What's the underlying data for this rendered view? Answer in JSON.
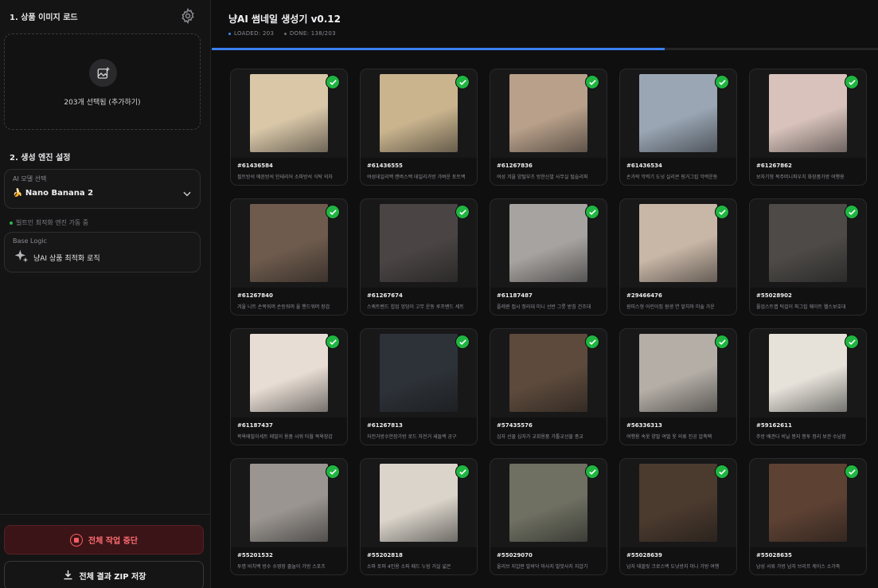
{
  "sidebar": {
    "section1_title": "1. 상품 이미지 로드",
    "upload_text": "203개 선택됨 (추가하기)",
    "section2_title": "2. 생성 엔진 설정",
    "model_label": "AI 모델 선택",
    "model_value": "🍌 Nano Banana 2",
    "engine_status": "빌트인 최적화 엔진 가동 중",
    "base_logic_label": "Base Logic",
    "base_logic_value": "냥AI 상품 최적화 로직",
    "stop_label": "전체 작업 중단",
    "zip_label": "전체 결과 ZIP 저장"
  },
  "header": {
    "title": "냥AI 썸네일 생성기 v0.12",
    "loaded": "LOADED: 203",
    "done": "DONE: 138/203",
    "progress": 0.68
  },
  "colors": {
    "accent": "#3b7ff0",
    "success": "#1fb541",
    "danger": "#ff5c63"
  },
  "products": [
    {
      "id": "#61436584",
      "name": "필트방석 에른방석 인테리어 소파방석 식탁 의자",
      "bg": "#d9c7a8"
    },
    {
      "id": "#61436555",
      "name": "여성데일리백 캔버스백 데일리가방 가벼운 토트백",
      "bg": "#c9b48e"
    },
    {
      "id": "#61267836",
      "name": "여성 겨울 양털부츠 방한신발 사무실 털슬리퍼",
      "bg": "#b8a08a"
    },
    {
      "id": "#61436534",
      "name": "손가락 악력기 도넛 실리콘 핑거그립 악력운동",
      "bg": "#9aa6b4"
    },
    {
      "id": "#61267862",
      "name": "보자기형 복주머니파우치 화장품가방 여행용",
      "bg": "#d8c2bb"
    },
    {
      "id": "#61267840",
      "name": "겨울 니트 손목워머 손등워머 울 핸드워머 장갑",
      "bg": "#6e5b4d"
    },
    {
      "id": "#61267674",
      "name": "스쿼트밴드 힙업 엉덩이 고무 운동 루프밴드 세트",
      "bg": "#4a4544"
    },
    {
      "id": "#61187487",
      "name": "플레퀸 접시 정리대 미니 선반 그릇 받침 건조대",
      "bg": "#a7a3a0"
    },
    {
      "id": "#29466476",
      "name": "원피스형 어린이집 원생 연 앞치마 미술 가운",
      "bg": "#c8b6a6"
    },
    {
      "id": "#55028902",
      "name": "풀업스트랩 턱걸이 파그립 웨이트 헬스보호대",
      "bg": "#4d4a47"
    },
    {
      "id": "#61187437",
      "name": "목욕때밀이세트 때밀이 용품 샤워 타월 목욕장갑",
      "bg": "#e8ddd4"
    },
    {
      "id": "#61267813",
      "name": "자전거방수안장가방 로드 자전거 새들백 공구",
      "bg": "#2d3238"
    },
    {
      "id": "#57435576",
      "name": "십자 선물 십자가 교회용품 가톨교선물 종교",
      "bg": "#5d4a3c"
    },
    {
      "id": "#56336313",
      "name": "여행용 속옷 양말 여벌 옷 의류 진공 압축팩",
      "bg": "#b4aea6"
    },
    {
      "id": "#59162611",
      "name": "주방 배관다 비닐 봉지 봉투 정리 보관 수납함",
      "bg": "#e6e2da"
    },
    {
      "id": "#55201532",
      "name": "투명 비치백 방수 수영장 줄놀이 가방 스포츠",
      "bg": "#9a9590"
    },
    {
      "id": "#55202818",
      "name": "소파 토퍼 4인용 소파 패드 누빔 거실 넓은",
      "bg": "#dad4ca"
    },
    {
      "id": "#55029070",
      "name": "올리브 지압판 발바닥 마사지 발맛사지 지압기",
      "bg": "#6f7062"
    },
    {
      "id": "#55028639",
      "name": "남자 태블릿 크로스백 도넛방지 미니 가방 여행",
      "bg": "#4b3a2e"
    },
    {
      "id": "#55028635",
      "name": "남성 서류 가방 남자 브리프 케이스 소가죽",
      "bg": "#5d4133"
    }
  ]
}
